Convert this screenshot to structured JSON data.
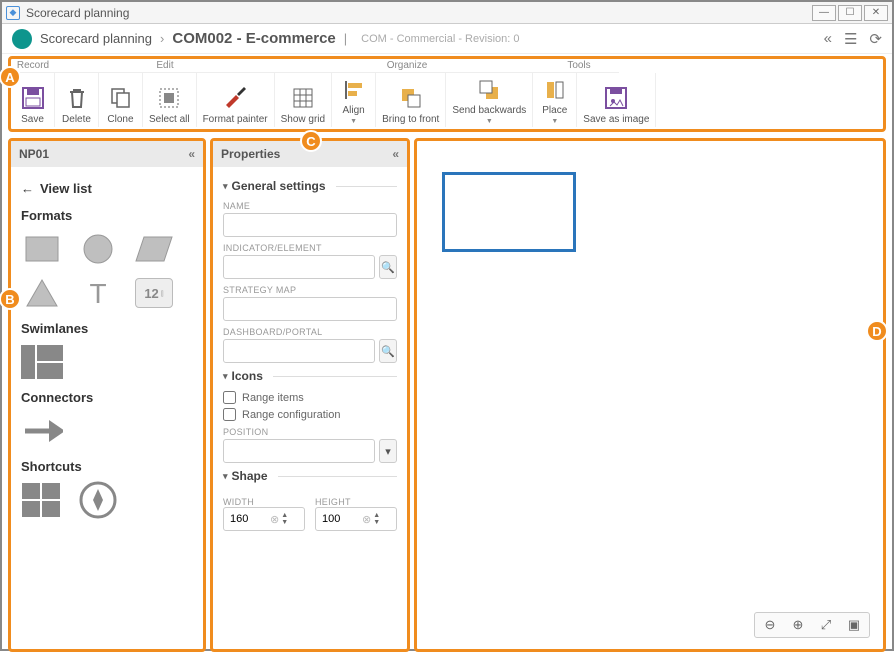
{
  "window": {
    "title": "Scorecard planning"
  },
  "breadcrumb": {
    "root": "Scorecard planning",
    "current": "COM002 - E-commerce",
    "meta": "COM - Commercial - Revision: 0"
  },
  "toolbar": {
    "groups": {
      "record": "Record",
      "edit": "Edit",
      "organize": "Organize",
      "tools": "Tools"
    },
    "buttons": {
      "save": "Save",
      "delete": "Delete",
      "clone": "Clone",
      "select_all": "Select all",
      "format_painter": "Format painter",
      "show_grid": "Show grid",
      "align": "Align",
      "bring_front": "Bring to front",
      "send_back": "Send backwards",
      "place": "Place",
      "save_image": "Save as image"
    }
  },
  "left_panel": {
    "title": "NP01",
    "view_list": "View list",
    "sections": {
      "formats": "Formats",
      "swimlanes": "Swimlanes",
      "connectors": "Connectors",
      "shortcuts": "Shortcuts"
    },
    "badge12": "12"
  },
  "properties": {
    "title": "Properties",
    "general": {
      "title": "General settings",
      "name_label": "NAME",
      "name_value": "",
      "indicator_label": "INDICATOR/ELEMENT",
      "indicator_value": "",
      "strategy_label": "STRATEGY MAP",
      "strategy_value": "",
      "dashboard_label": "DASHBOARD/PORTAL",
      "dashboard_value": ""
    },
    "icons": {
      "title": "Icons",
      "range_items": "Range items",
      "range_config": "Range configuration",
      "position_label": "POSITION",
      "position_value": ""
    },
    "shape": {
      "title": "Shape",
      "width_label": "WIDTH",
      "width_value": "160",
      "height_label": "HEIGHT",
      "height_value": "100"
    }
  },
  "callouts": {
    "a": "A",
    "b": "B",
    "c": "C",
    "d": "D"
  },
  "chart_data": null
}
